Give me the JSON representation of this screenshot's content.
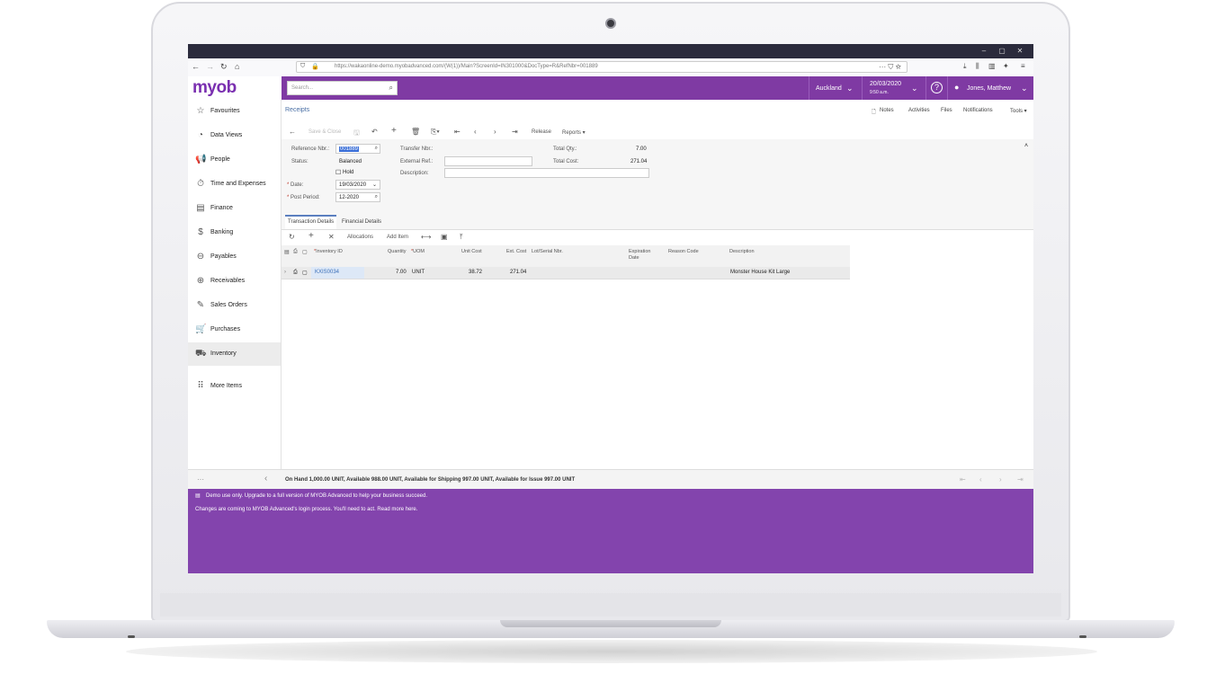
{
  "browser": {
    "window_buttons": [
      "–",
      "▢",
      "✕"
    ],
    "url": "https://wakaonline-demo.myobadvanced.com/(W(1))/Main?ScreenId=IN301000&DocType=R&RefNbr=001889",
    "more": "···"
  },
  "app": {
    "logo": "myob",
    "search_placeholder": "Search...",
    "branch": "Auckland",
    "date": "20/03/2020",
    "time": "9:50 a.m.",
    "user": "Jones, Matthew"
  },
  "sidebar": {
    "items": [
      {
        "label": "Favourites",
        "icon": "star-icon",
        "glyph": "☆"
      },
      {
        "label": "Data Views",
        "icon": "pie-chart-icon",
        "glyph": "◔"
      },
      {
        "label": "People",
        "icon": "megaphone-icon",
        "glyph": "📢"
      },
      {
        "label": "Time and Expenses",
        "icon": "stopwatch-icon",
        "glyph": "⏱"
      },
      {
        "label": "Finance",
        "icon": "calculator-icon",
        "glyph": "▤"
      },
      {
        "label": "Banking",
        "icon": "dollar-icon",
        "glyph": "$"
      },
      {
        "label": "Payables",
        "icon": "minus-circle-icon",
        "glyph": "⊖"
      },
      {
        "label": "Receivables",
        "icon": "plus-circle-icon",
        "glyph": "⊕"
      },
      {
        "label": "Sales Orders",
        "icon": "edit-icon",
        "glyph": "✎"
      },
      {
        "label": "Purchases",
        "icon": "cart-icon",
        "glyph": "🛒"
      },
      {
        "label": "Inventory",
        "icon": "truck-icon",
        "glyph": "⛟"
      },
      {
        "label": "More Items",
        "icon": "grid-dots-icon",
        "glyph": "⠿"
      }
    ],
    "collapse_more": "···",
    "collapse_arrow": "‹"
  },
  "page": {
    "breadcrumb": "Receipts",
    "header_links": [
      "Notes",
      "Activities",
      "Files",
      "Notifications",
      "Tools ▾"
    ],
    "toolbar": {
      "save_close": "Save & Close",
      "release": "Release",
      "reports": "Reports ▾"
    },
    "form": {
      "reference_nbr_label": "Reference Nbr.:",
      "reference_nbr": "001889",
      "status_label": "Status:",
      "status": "Balanced",
      "hold_label": "Hold",
      "date_label": "Date:",
      "date": "19/03/2020",
      "post_period_label": "Post Period:",
      "post_period": "12-2020",
      "transfer_nbr_label": "Transfer Nbr.:",
      "external_ref_label": "External Ref.:",
      "description_label": "Description:",
      "total_qty_label": "Total Qty.:",
      "total_qty": "7.00",
      "total_cost_label": "Total Cost:",
      "total_cost": "271.04"
    },
    "tabs": [
      "Transaction Details",
      "Financial Details"
    ],
    "grid_toolbar": {
      "allocations": "Allocations",
      "add_item": "Add Item"
    },
    "grid": {
      "columns": [
        "Inventory ID",
        "Quantity",
        "UOM",
        "Unit Cost",
        "Ext. Cost",
        "Lot/Serial Nbr.",
        "Expiration Date",
        "Reason Code",
        "Description"
      ],
      "rows": [
        {
          "inventory_id": "KXIS0034",
          "quantity": "7.00",
          "uom": "UNIT",
          "unit_cost": "38.72",
          "ext_cost": "271.04",
          "lot_serial": "",
          "expiration": "",
          "reason": "",
          "description": "Monster House Kit Large"
        }
      ]
    }
  },
  "status_bar": {
    "text": "On Hand 1,000.00 UNIT, Available 988.00 UNIT, Available for Shipping 997.00 UNIT, Available for Issue 997.00 UNIT"
  },
  "banner": {
    "line1": "Demo use only. Upgrade to a full version of MYOB Advanced to help your business succeed.",
    "line2": "Changes are coming to MYOB Advanced's login process. You'll need to act. Read more here."
  }
}
